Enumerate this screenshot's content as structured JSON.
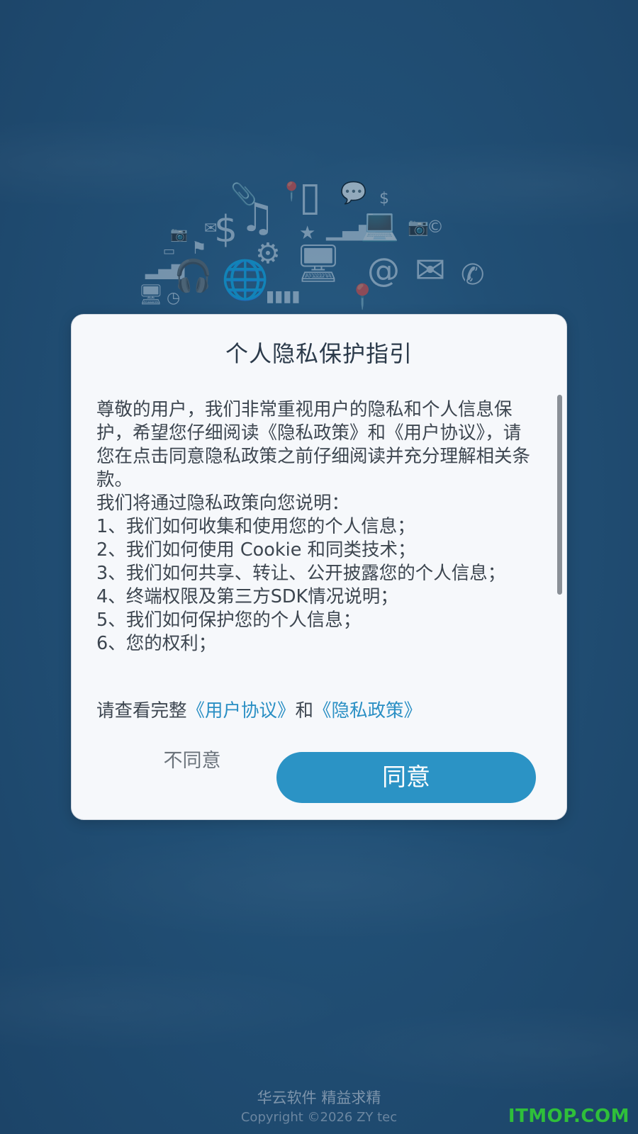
{
  "dialog": {
    "title": "个人隐私保护指引",
    "paragraphs": [
      "尊敬的用户，我们非常重视用户的隐私和个人信息保护，希望您仔细阅读《隐私政策》和《用户协议》，请您在点击同意隐私政策之前仔细阅读并充分理解相关条款。",
      "我们将通过隐私政策向您说明：",
      "1、我们如何收集和使用您的个人信息；",
      "2、我们如何使用 Cookie 和同类技术；",
      "3、我们如何共享、转让、公开披露您的个人信息；",
      "4、终端权限及第三方SDK情况说明；",
      "5、我们如何保护您的个人信息；",
      "6、您的权利；"
    ],
    "links_prefix": "请查看完整",
    "user_agreement_link": "《用户协议》",
    "links_and": "和",
    "privacy_policy_link": "《隐私政策》",
    "disagree_label": "不同意",
    "agree_label": "同意"
  },
  "footer": {
    "brand": "华云软件 精益求精",
    "copyright": "Copyright ©2026 ZY tec"
  },
  "watermark": "ITMOP.COM",
  "colors": {
    "background": "#214f75",
    "dialog_bg": "#f6f8fb",
    "link": "#2a8fc4",
    "agree_button": "#2b93c5",
    "watermark": "#2fbf3a"
  }
}
